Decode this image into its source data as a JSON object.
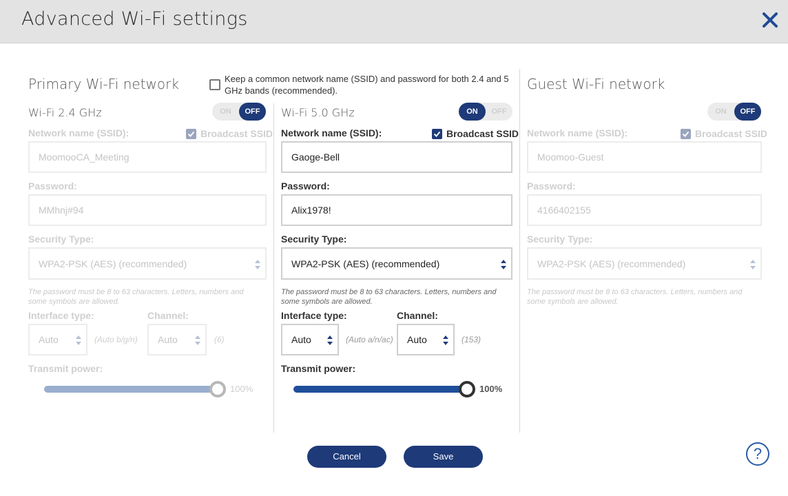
{
  "header": {
    "title": "Advanced Wi-Fi settings"
  },
  "primary": {
    "title": "Primary Wi-Fi network",
    "common_ssid_text": "Keep a common network name (SSID) and password for both 2.4 and 5 GHz bands (recommended).",
    "common_ssid_checked": false
  },
  "band24": {
    "title": "Wi-Fi 2.4 GHz",
    "toggle_on": "ON",
    "toggle_off": "OFF",
    "state": "off",
    "ssid_label": "Network name (SSID):",
    "broadcast_label": "Broadcast SSID",
    "broadcast_checked": true,
    "ssid_value": "MoomooCA_Meeting",
    "password_label": "Password:",
    "password_value": "MMhnj#94",
    "security_label": "Security Type:",
    "security_value": "WPA2-PSK (AES) (recommended)",
    "password_help": "The password must be 8 to 63 characters. Letters, numbers and some symbols are allowed.",
    "interface_label": "Interface type:",
    "interface_value": "Auto",
    "interface_aux": "(Auto b/g/n)",
    "channel_label": "Channel:",
    "channel_value": "Auto",
    "channel_aux": "(6)",
    "power_label": "Transmit power:",
    "power_value": "100%",
    "power_fraction": 1.0
  },
  "band50": {
    "title": "Wi-Fi 5.0 GHz",
    "toggle_on": "ON",
    "toggle_off": "OFF",
    "state": "on",
    "ssid_label": "Network name (SSID):",
    "broadcast_label": "Broadcast SSID",
    "broadcast_checked": true,
    "ssid_value": "Gaoge-Bell",
    "password_label": "Password:",
    "password_value": "Alix1978!",
    "security_label": "Security Type:",
    "security_value": "WPA2-PSK (AES) (recommended)",
    "password_help": "The password must be 8 to 63 characters. Letters, numbers and some symbols are allowed.",
    "interface_label": "Interface type:",
    "interface_value": "Auto",
    "interface_aux": "(Auto a/n/ac)",
    "channel_label": "Channel:",
    "channel_value": "Auto",
    "channel_aux": "(153)",
    "power_label": "Transmit power:",
    "power_value": "100%",
    "power_fraction": 1.0
  },
  "guest": {
    "title": "Guest Wi-Fi network",
    "toggle_on": "ON",
    "toggle_off": "OFF",
    "state": "off",
    "ssid_label": "Network name (SSID):",
    "broadcast_label": "Broadcast SSID",
    "broadcast_checked": true,
    "ssid_value": "Moomoo-Guest",
    "password_label": "Password:",
    "password_value": "4166402155",
    "security_label": "Security Type:",
    "security_value": "WPA2-PSK (AES) (recommended)",
    "password_help": "The password must be 8 to 63 characters. Letters, numbers and some symbols are allowed."
  },
  "footer": {
    "cancel_label": "Cancel",
    "save_label": "Save",
    "help_label": "?"
  },
  "colors": {
    "accent": "#1e3a78",
    "header_bg": "#e3e3e3",
    "help_blue": "#2b5aa8"
  }
}
